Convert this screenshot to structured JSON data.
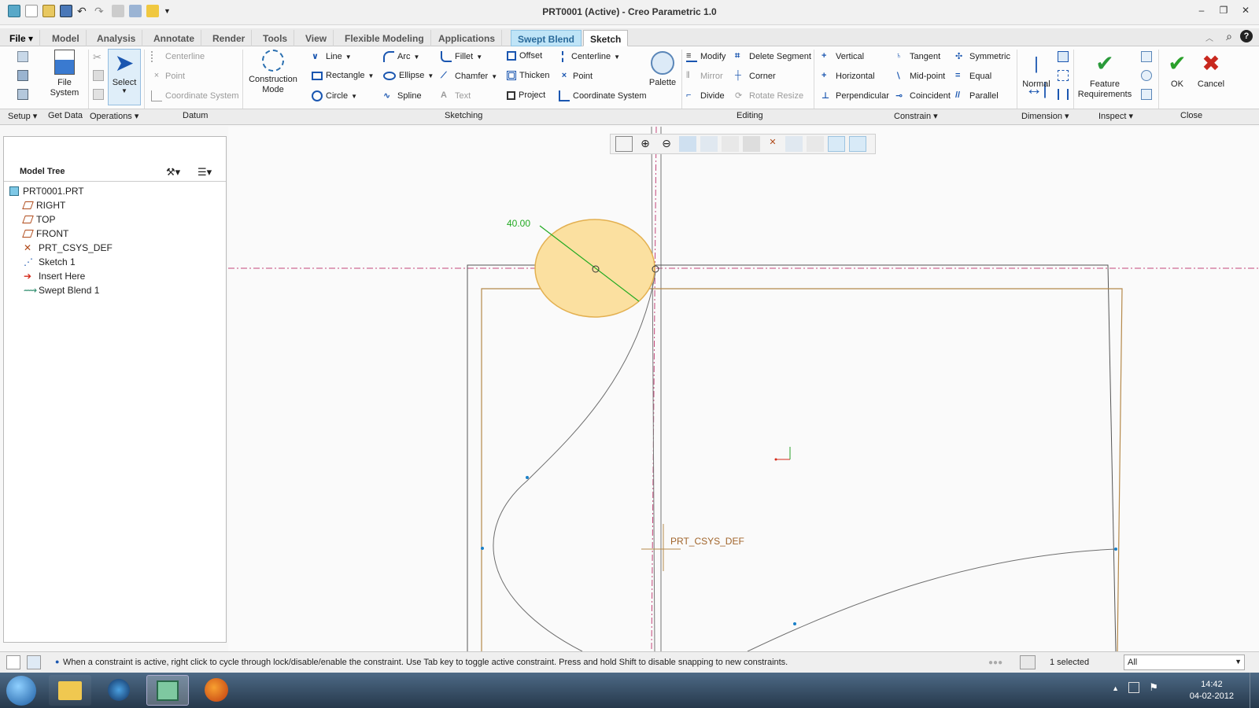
{
  "window": {
    "title": "PRT0001 (Active) - Creo Parametric 1.0",
    "controls": [
      "minimize",
      "restore",
      "close"
    ]
  },
  "tabs": [
    {
      "label": "File",
      "state": "menu"
    },
    {
      "label": "Model",
      "state": "normal"
    },
    {
      "label": "Analysis",
      "state": "normal"
    },
    {
      "label": "Annotate",
      "state": "normal"
    },
    {
      "label": "Render",
      "state": "normal"
    },
    {
      "label": "Tools",
      "state": "normal"
    },
    {
      "label": "View",
      "state": "normal"
    },
    {
      "label": "Flexible Modeling",
      "state": "normal"
    },
    {
      "label": "Applications",
      "state": "normal"
    },
    {
      "label": "Swept Blend",
      "state": "context"
    },
    {
      "label": "Sketch",
      "state": "active"
    }
  ],
  "ribbon": {
    "get_data": {
      "file_system": "File System"
    },
    "operations": {
      "select": "Select"
    },
    "datum": {
      "centerline": "Centerline",
      "point": "Point",
      "coordinate_system": "Coordinate System"
    },
    "sketching": {
      "construction_mode": "Construction Mode",
      "line": "Line",
      "rectangle": "Rectangle",
      "circle": "Circle",
      "arc": "Arc",
      "ellipse": "Ellipse",
      "spline": "Spline",
      "fillet": "Fillet",
      "chamfer": "Chamfer",
      "text": "Text",
      "offset": "Offset",
      "thicken": "Thicken",
      "project": "Project",
      "centerline": "Centerline",
      "point": "Point",
      "coordinate_system": "Coordinate System",
      "palette": "Palette"
    },
    "editing": {
      "modify": "Modify",
      "mirror": "Mirror",
      "divide": "Divide",
      "delete_segment": "Delete Segment",
      "corner": "Corner",
      "rotate_resize": "Rotate Resize"
    },
    "constrain": {
      "vertical": "Vertical",
      "horizontal": "Horizontal",
      "perpendicular": "Perpendicular",
      "tangent": "Tangent",
      "mid_point": "Mid-point",
      "coincident": "Coincident",
      "symmetric": "Symmetric",
      "equal": "Equal",
      "parallel": "Parallel"
    },
    "dimension": {
      "normal": "Normal"
    },
    "inspect": {
      "feature_requirements": "Feature Requirements"
    },
    "close": {
      "ok": "OK",
      "cancel": "Cancel"
    },
    "groups": {
      "setup": "Setup",
      "get_data": "Get Data",
      "operations": "Operations",
      "datum": "Datum",
      "sketching": "Sketching",
      "editing": "Editing",
      "constrain": "Constrain",
      "dimension": "Dimension",
      "inspect": "Inspect",
      "close": "Close"
    }
  },
  "model_tree": {
    "title": "Model Tree",
    "root": "PRT0001.PRT",
    "items": [
      {
        "label": "RIGHT",
        "icon": "datum-plane-icon"
      },
      {
        "label": "TOP",
        "icon": "datum-plane-icon"
      },
      {
        "label": "FRONT",
        "icon": "datum-plane-icon"
      },
      {
        "label": "PRT_CSYS_DEF",
        "icon": "csys-icon"
      },
      {
        "label": "Sketch 1",
        "icon": "sketch-icon"
      },
      {
        "label": "Insert Here",
        "icon": "insert-arrow-icon"
      },
      {
        "label": "Swept Blend 1",
        "icon": "swept-blend-icon"
      }
    ]
  },
  "graphics": {
    "dimension_value": "40.00",
    "csys_label": "PRT_CSYS_DEF"
  },
  "status": {
    "message": "When a constraint is active, right click to cycle through lock/disable/enable the constraint. Use Tab key to toggle active constraint. Press and hold Shift to disable snapping to new constraints.",
    "selection": "1 selected",
    "filter": "All"
  },
  "taskbar": {
    "time": "14:42",
    "date": "04-02-2012"
  },
  "colors": {
    "sketch_line": "#b5894a",
    "curve": "#6e6e6e",
    "dimension": "#22aa22",
    "centerline": "#c4467a",
    "ellipse_fill": "#fbe0a0",
    "ellipse_stroke": "#e3b050",
    "swept_blend_tab": "#bfe4f7"
  }
}
